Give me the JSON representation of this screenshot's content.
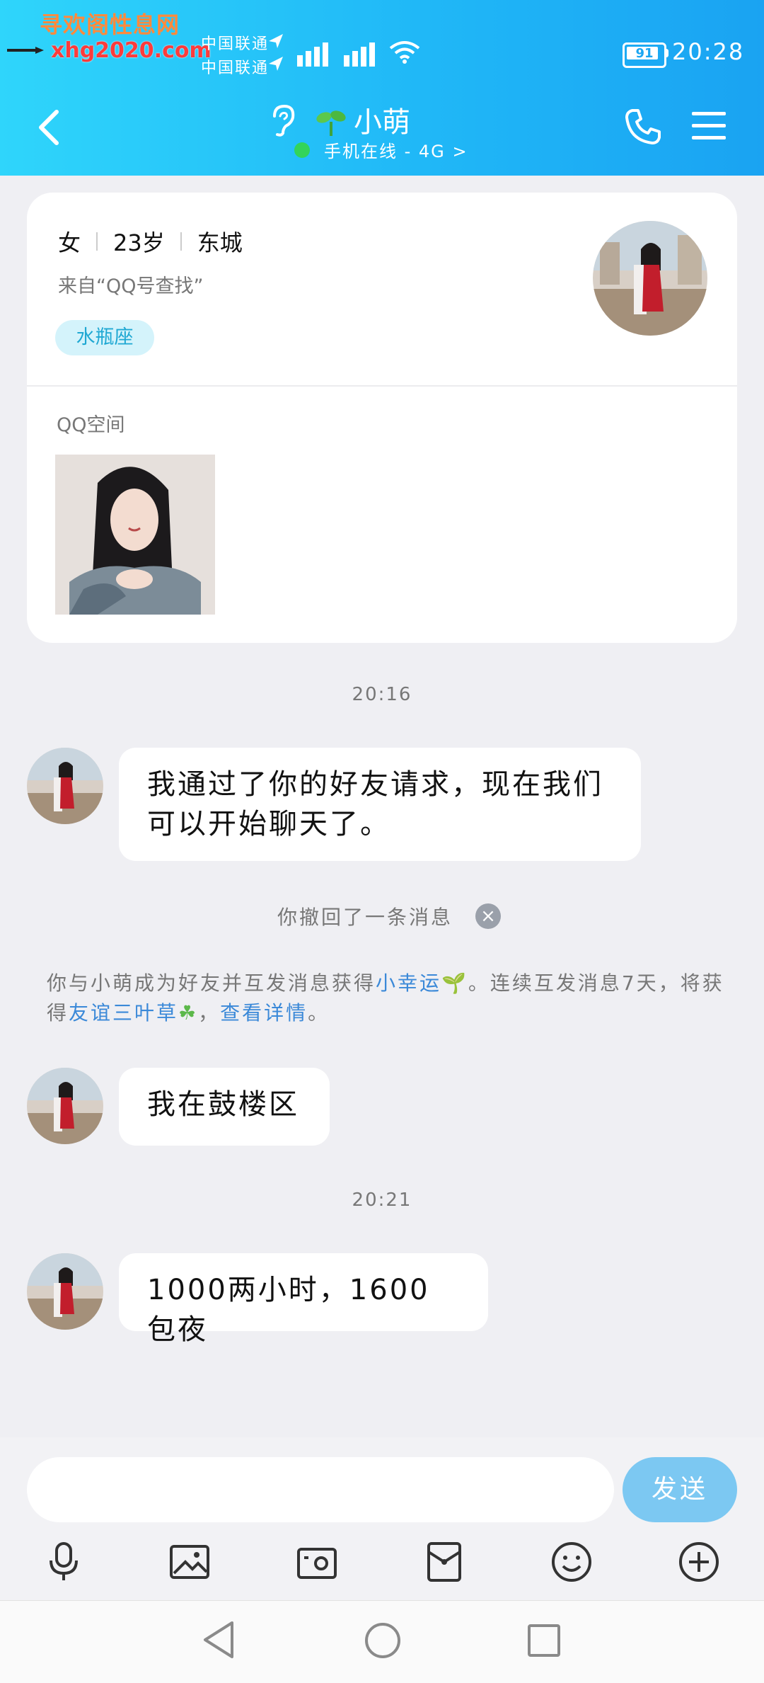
{
  "watermark": {
    "site_name": "寻欢阁性息网",
    "url": "xhg2020.com"
  },
  "status_bar": {
    "carrier1": "中国联通",
    "carrier2": "中国联通",
    "battery": "91",
    "time": "20:28"
  },
  "header": {
    "back_icon": "chevron-left-icon",
    "ear_icon": "ear-icon",
    "sprout_icon": "sprout-icon",
    "contact_name": "小萌",
    "status": "手机在线 - 4G",
    "status_arrow": ">",
    "call_icon": "phone-icon",
    "menu_icon": "menu-icon",
    "online_color": "#33d45a"
  },
  "profile": {
    "gender": "女",
    "age": "23岁",
    "location": "东城",
    "source": "来自“QQ号查找”",
    "tag": "水瓶座",
    "qzone_label": "QQ空间"
  },
  "messages": {
    "ts1": "20:16",
    "msg1": "我通过了你的好友请求，现在我们可以开始聊天了。",
    "recall_text": "你撤回了一条消息",
    "recall_close": "×",
    "sys_part1": "你与小萌成为好友并互发消息获得",
    "sys_link1": "小幸运",
    "sys_part2": "。连续互发消息7天，将获得",
    "sys_link2": "友谊三叶草",
    "sys_part3": "，",
    "sys_link3": "查看详情",
    "sys_part4": "。",
    "msg2": "我在鼓楼区",
    "ts2": "20:21",
    "msg3": "1000两小时，1600包夜"
  },
  "input": {
    "placeholder": "",
    "send_label": "发送"
  },
  "toolbar": {
    "items": [
      "microphone-icon",
      "image-icon",
      "camera-icon",
      "red-packet-icon",
      "emoji-icon",
      "plus-icon"
    ]
  },
  "navbar": {
    "items": [
      "nav-back-icon",
      "nav-home-icon",
      "nav-recents-icon"
    ]
  },
  "colors": {
    "header_start": "#2fd5fb",
    "header_end": "#1aa3f2",
    "send_button": "#7cc8f2",
    "link": "#3b89d8",
    "tag_bg": "#d4f3fb"
  }
}
